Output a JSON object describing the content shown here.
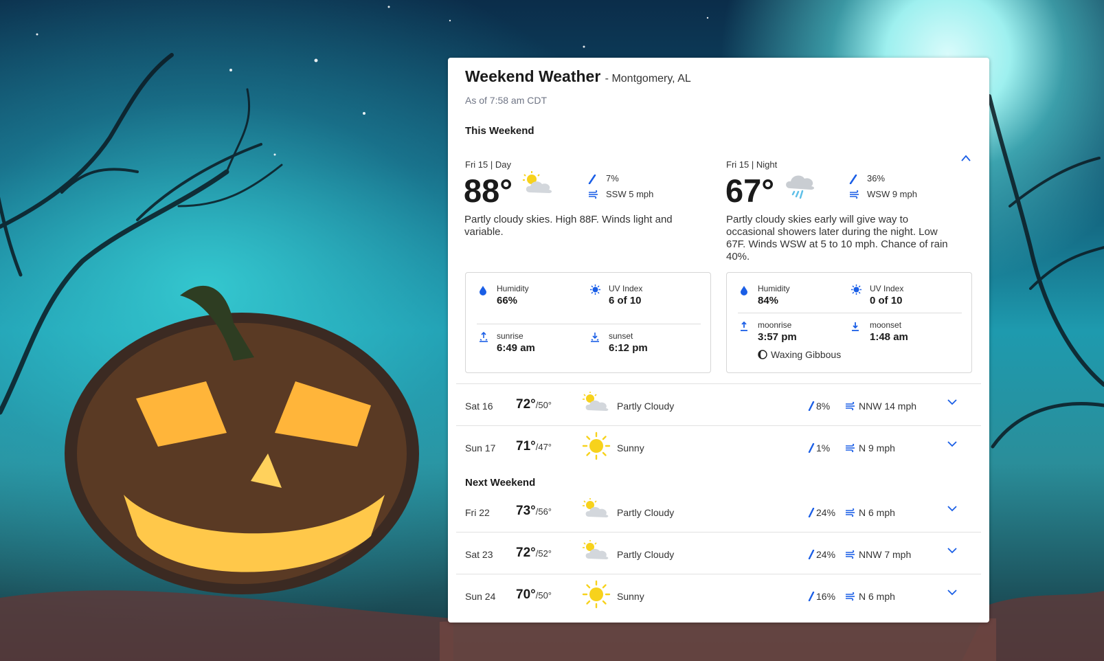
{
  "header": {
    "title": "Weekend Weather",
    "location": "- Montgomery, AL",
    "as_of": "As of 7:58 am CDT"
  },
  "sections": {
    "this_weekend": "This Weekend",
    "next_weekend": "Next Weekend"
  },
  "today": {
    "day": {
      "date": "Fri 15",
      "period": "| Day",
      "temp": "88°",
      "icon": "partly-cloudy-icon",
      "precip": "7%",
      "wind": "SSW 5 mph",
      "description": "Partly cloudy skies. High 88F. Winds light and variable.",
      "humidity_label": "Humidity",
      "humidity": "66%",
      "uv_label": "UV Index",
      "uv": "6 of 10",
      "rise_label": "sunrise",
      "rise": "6:49 am",
      "set_label": "sunset",
      "set": "6:12 pm"
    },
    "night": {
      "date": "Fri 15",
      "period": "| Night",
      "temp": "67°",
      "icon": "night-showers-icon",
      "precip": "36%",
      "wind": "WSW 9 mph",
      "description": "Partly cloudy skies early will give way to occasional showers later during the night. Low 67F. Winds WSW at 5 to 10 mph. Chance of rain 40%.",
      "humidity_label": "Humidity",
      "humidity": "84%",
      "uv_label": "UV Index",
      "uv": "0 of 10",
      "rise_label": "moonrise",
      "rise": "3:57 pm",
      "set_label": "moonset",
      "set": "1:48 am",
      "moon_phase": "Waxing Gibbous"
    }
  },
  "this_weekend_rows": [
    {
      "date": "Sat 16",
      "hi": "72°",
      "lo": "/50°",
      "icon": "partly-cloudy-icon",
      "phrase": "Partly Cloudy",
      "precip": "8%",
      "wind": "NNW 14 mph"
    },
    {
      "date": "Sun 17",
      "hi": "71°",
      "lo": "/47°",
      "icon": "sunny-icon",
      "phrase": "Sunny",
      "precip": "1%",
      "wind": "N 9 mph"
    }
  ],
  "next_weekend_rows": [
    {
      "date": "Fri 22",
      "hi": "73°",
      "lo": "/56°",
      "icon": "partly-cloudy-icon",
      "phrase": "Partly Cloudy",
      "precip": "24%",
      "wind": "N 6 mph"
    },
    {
      "date": "Sat 23",
      "hi": "72°",
      "lo": "/52°",
      "icon": "partly-cloudy-icon",
      "phrase": "Partly Cloudy",
      "precip": "24%",
      "wind": "NNW 7 mph"
    },
    {
      "date": "Sun 24",
      "hi": "70°",
      "lo": "/50°",
      "icon": "sunny-icon",
      "phrase": "Sunny",
      "precip": "16%",
      "wind": "N 6 mph"
    }
  ],
  "colors": {
    "accent": "#1a5ee6",
    "card": "#ffffff",
    "sun": "#f7d21c",
    "cloud": "#d3d7dc"
  }
}
